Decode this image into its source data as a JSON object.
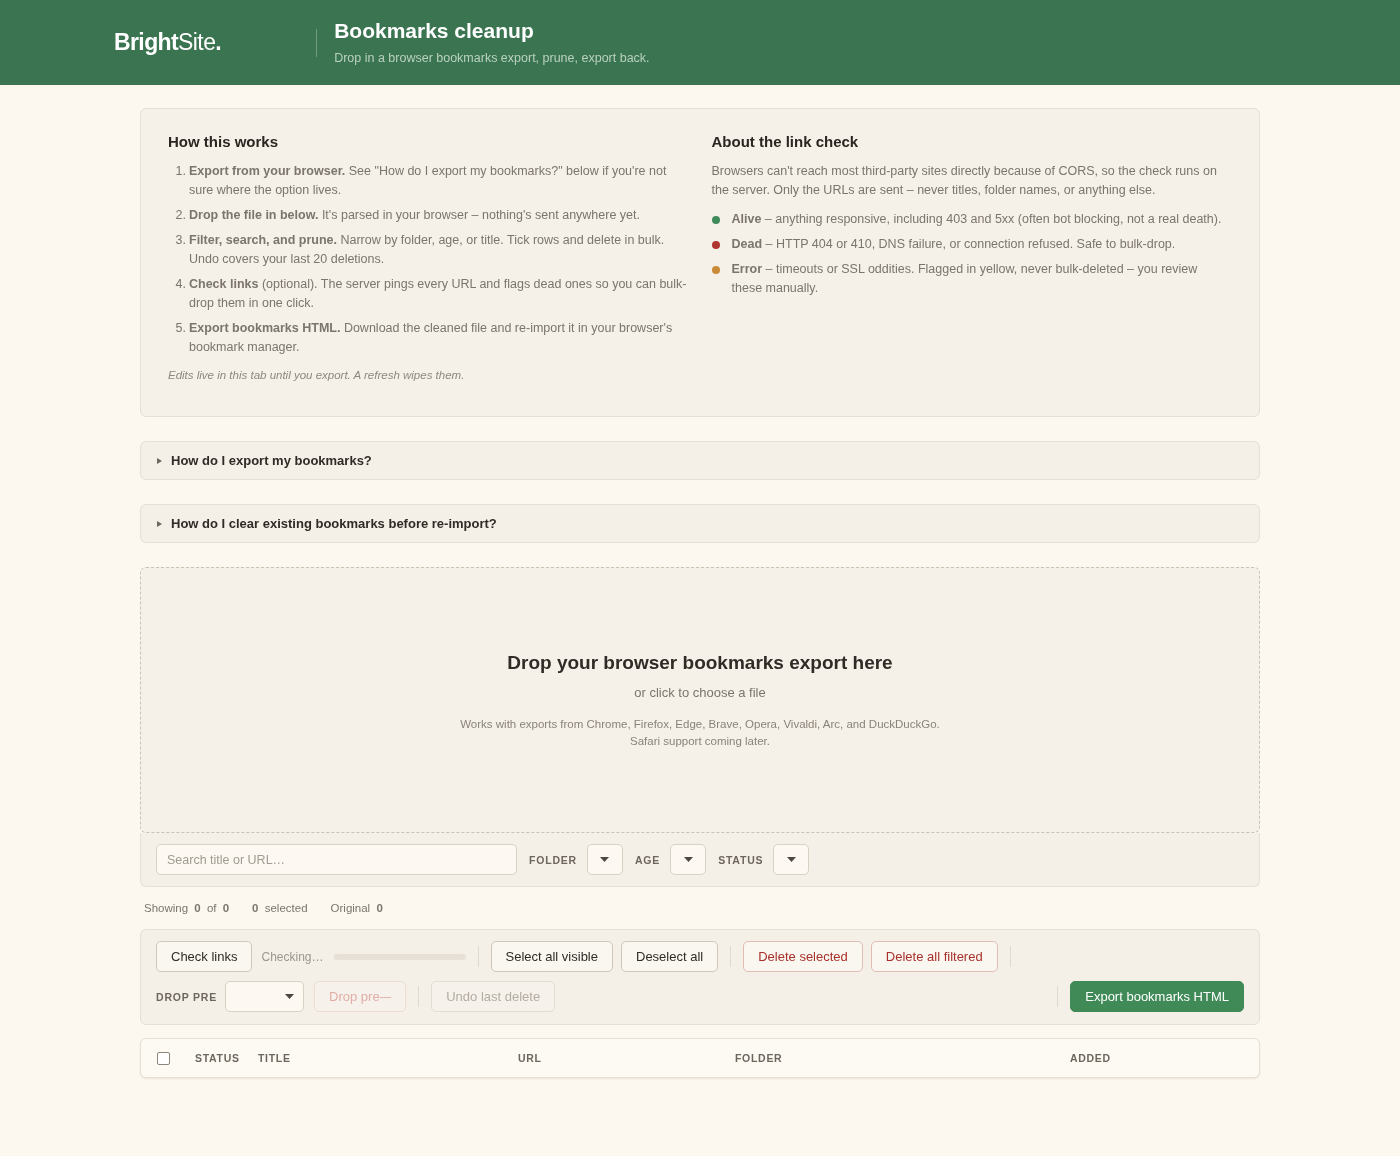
{
  "header": {
    "logo": "**Bright**Site**.**",
    "title": "Bookmarks cleanup",
    "subtitle": "Drop in a browser bookmarks export, prune, export back."
  },
  "info": {
    "how": {
      "title": "How this works",
      "steps": [
        {
          "number": "1.",
          "text": "**Export from your browser.** See \"How do I export my bookmarks?\" below if you're not sure where the option lives."
        },
        {
          "number": "2.",
          "text": "**Drop the file in below.** It's parsed in your browser – nothing's sent anywhere yet."
        },
        {
          "number": "3.",
          "text": "**Filter, search, and prune.** Narrow by folder, age, or title. Tick rows and delete in bulk. Undo covers your last 20 deletions."
        },
        {
          "number": "4.",
          "text": "**Check links** (optional). The server pings every URL and flags dead ones so you can bulk-drop them in one click."
        },
        {
          "number": "5.",
          "text": "**Export bookmarks HTML.** Download the cleaned file and re-import it in your browser's bookmark manager."
        }
      ],
      "note": "Edits live in this tab until you export. A refresh wipes them."
    },
    "about": {
      "title": "About the link check",
      "intro": "Browsers can't reach most third-party sites directly because of CORS, so the check runs on the server. Only the URLs are sent – never titles, folder names, or anything else.",
      "statuses": [
        {
          "text": "**Alive** – anything responsive, including 403 and 5xx (often bot blocking, not a real death).",
          "color": "#3f8a5a"
        },
        {
          "text": "**Dead** – HTTP 404 or 410, DNS failure, or connection refused. Safe to bulk-drop.",
          "color": "#b0352f"
        },
        {
          "text": "**Error** – timeouts or SSL oddities. Flagged in yellow, never bulk-deleted – you review these manually.",
          "color": "#c98b38"
        }
      ]
    }
  },
  "faq": [
    {
      "question": "How do I export my bookmarks?",
      "expanded": false
    },
    {
      "question": "How do I clear existing bookmarks before re-import?",
      "expanded": false
    }
  ],
  "dropzone": {
    "title": "Drop your browser bookmarks export here",
    "subtitle": "or click to choose a file",
    "note_lines": [
      "Works with exports from Chrome, Firefox, Edge, Brave, Opera, Vivaldi, Arc, and DuckDuckGo.",
      "Safari support coming later."
    ]
  },
  "filters": {
    "search": {
      "placeholder": "Search title or URL…"
    },
    "selects": [
      {
        "label": "FOLDER"
      },
      {
        "label": "AGE"
      },
      {
        "label": "STATUS"
      }
    ]
  },
  "stats": [
    "Showing **0** of **0**",
    "**0** selected",
    "Original **0**"
  ],
  "toolbar": {
    "rows": [
      {
        "items": [
          {
            "kind": "button",
            "label": "Check links",
            "disabled": false
          },
          {
            "kind": "status",
            "text": "Checking…"
          },
          {
            "kind": "progress",
            "level": 0
          },
          {
            "kind": "separator"
          },
          {
            "kind": "button",
            "label": "Select all visible",
            "disabled": false
          },
          {
            "kind": "button",
            "label": "Deselect all",
            "disabled": false
          },
          {
            "kind": "separator"
          },
          {
            "kind": "danger",
            "label": "Delete selected",
            "disabled": false
          },
          {
            "kind": "danger",
            "label": "Delete all filtered",
            "disabled": false
          },
          {
            "kind": "separator"
          }
        ]
      },
      {
        "items": [
          {
            "kind": "select",
            "label": "DROP PRE"
          },
          {
            "kind": "danger",
            "label": "Drop pre-–",
            "disabled": true
          },
          {
            "kind": "separator"
          },
          {
            "kind": "button",
            "label": "Undo last delete",
            "disabled": true
          }
        ],
        "end_items": [
          {
            "kind": "separator"
          },
          {
            "kind": "primary",
            "label": "Export bookmarks HTML",
            "disabled": false
          }
        ]
      }
    ]
  },
  "table": {
    "select_all": {
      "checked": false
    },
    "columns": [
      "STATUS",
      "TITLE",
      "URL",
      "FOLDER",
      "ADDED"
    ]
  }
}
